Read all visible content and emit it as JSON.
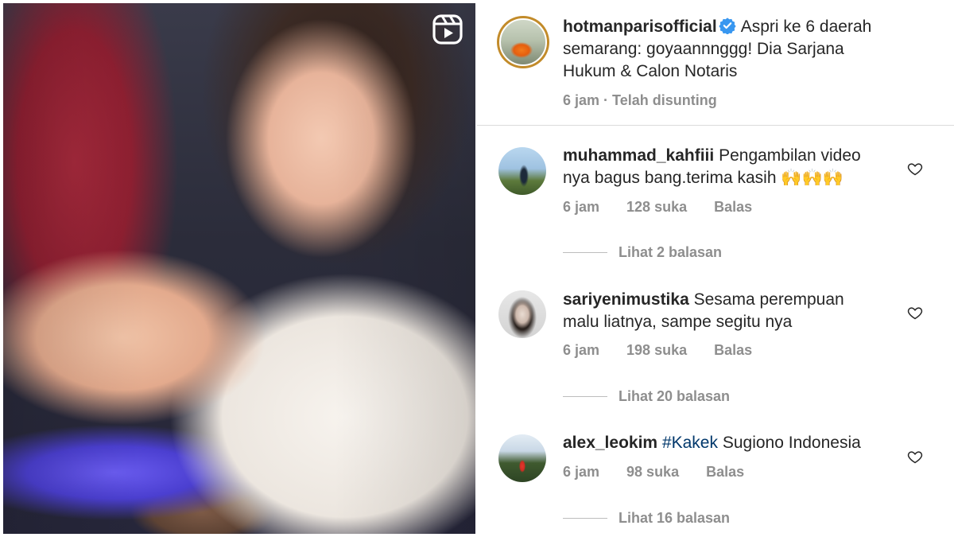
{
  "post": {
    "username": "hotmanparisofficial",
    "caption": "Aspri ke 6 daerah semarang: goyaannnggg! Dia Sarjana Hukum & Calon Notaris",
    "caption_line1": "Aspri ke 6 daerah",
    "caption_line2": "semarang: goyaannnggg! Dia Sarjana",
    "caption_line3": "Hukum & Calon Notaris",
    "time": "6 jam",
    "edited": "Telah disunting",
    "verified": true
  },
  "comments": [
    {
      "username": "muhammad_kahfiii",
      "text_line1": "Pengambilan video",
      "text_line2": "nya bagus bang.terima kasih 🙌🙌🙌",
      "time": "6 jam",
      "likes": "128 suka",
      "reply_label": "Balas",
      "view_replies": "Lihat 2 balasan"
    },
    {
      "username": "sariyenimustika",
      "text_line1": "Sesama perempuan",
      "text_line2": "malu liatnya, sampe segitu nya",
      "time": "6 jam",
      "likes": "198 suka",
      "reply_label": "Balas",
      "view_replies": "Lihat 20 balasan"
    },
    {
      "username": "alex_leokim",
      "hashtag": "#Kakek",
      "text_line1": "Sugiono Indonesia",
      "time": "6 jam",
      "likes": "98 suka",
      "reply_label": "Balas",
      "view_replies": "Lihat 16 balasan"
    }
  ],
  "icons": {
    "reels": "reels-icon",
    "verified": "verified-badge-icon",
    "like": "heart-outline-icon"
  },
  "colors": {
    "verified_blue": "#3897f0",
    "meta_gray": "#8e8e8e",
    "hashtag_blue": "#00376b"
  }
}
